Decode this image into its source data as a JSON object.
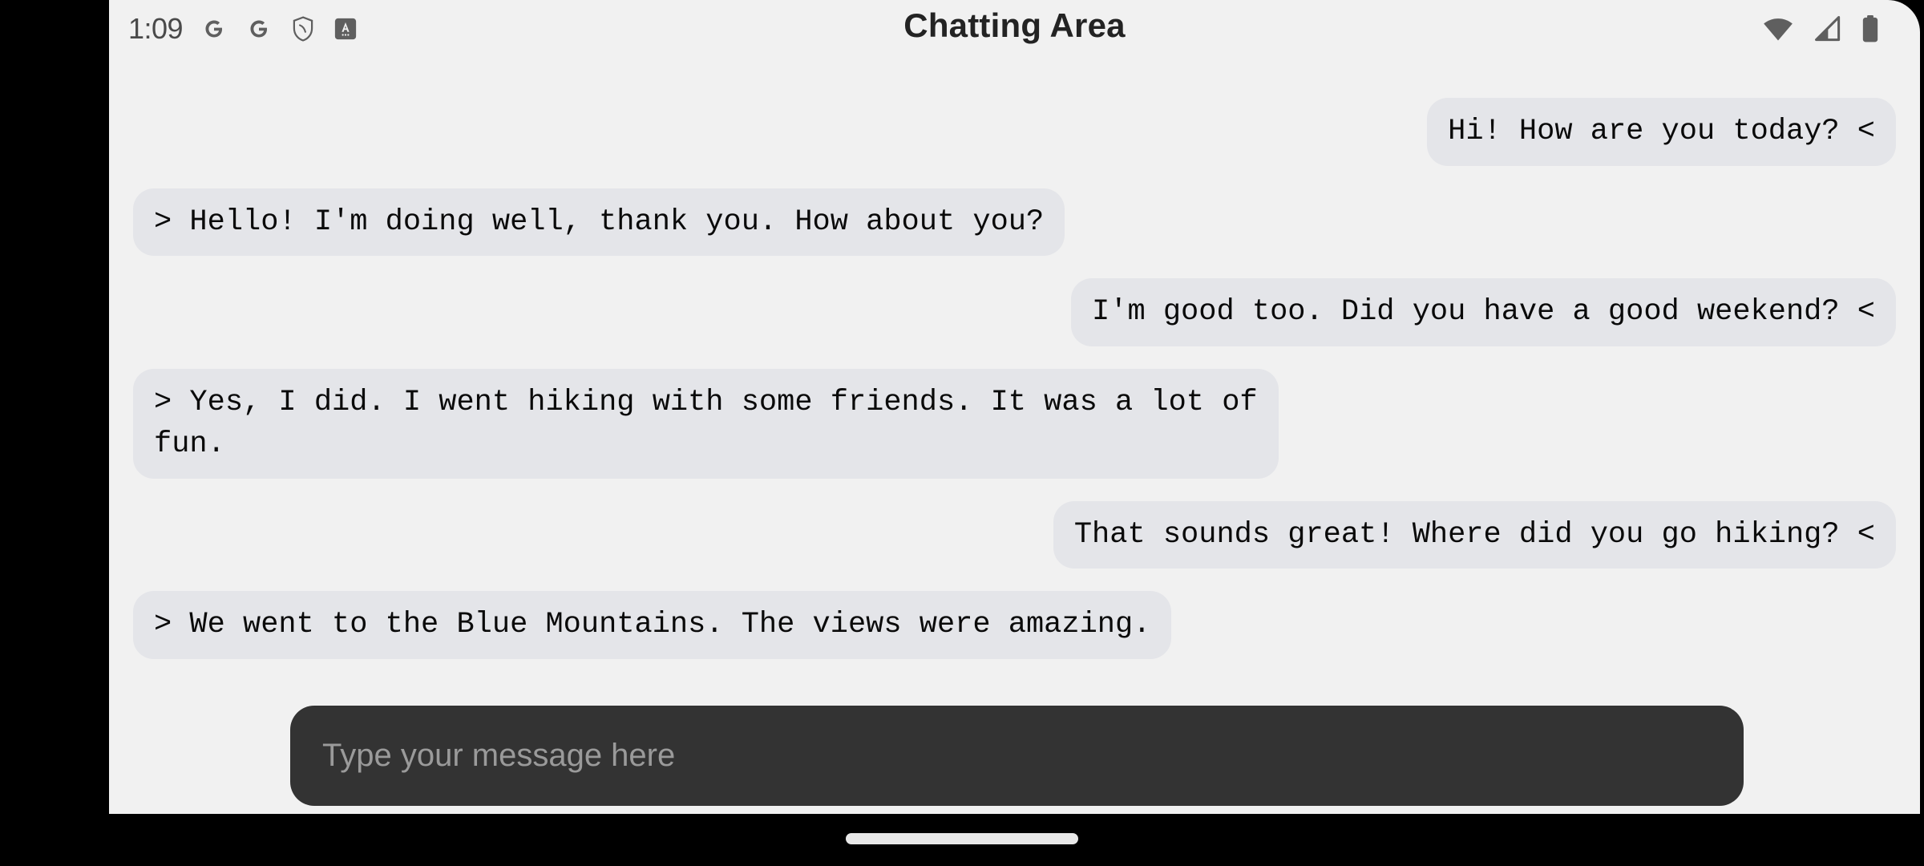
{
  "status_bar": {
    "clock": "1:09",
    "left_icons": [
      {
        "name": "google-icon",
        "label": "G"
      },
      {
        "name": "google-icon-2",
        "label": "G"
      },
      {
        "name": "shield-icon",
        "label": "shield"
      },
      {
        "name": "accessibility-badge-icon",
        "label": "A"
      }
    ],
    "right_icons": [
      {
        "name": "wifi-icon",
        "label": "wifi"
      },
      {
        "name": "cellular-signal-icon",
        "label": "signal"
      },
      {
        "name": "battery-icon",
        "label": "battery"
      }
    ]
  },
  "header": {
    "title": "Chatting Area"
  },
  "chat": {
    "messages": [
      {
        "side": "right",
        "text": "Hi! How are you today? <"
      },
      {
        "side": "left",
        "text": "> Hello! I'm doing well, thank you. How about you?"
      },
      {
        "side": "right",
        "text": "I'm good too. Did you have a good weekend? <"
      },
      {
        "side": "left",
        "text": "> Yes, I did. I went hiking with some friends. It was a lot of\nfun."
      },
      {
        "side": "right",
        "text": "That sounds great! Where did you go hiking? <"
      },
      {
        "side": "left",
        "text": "> We went to the Blue Mountains. The views were amazing."
      }
    ]
  },
  "composer": {
    "placeholder": "Type your message here",
    "value": ""
  },
  "navigation": {
    "home_indicator": "home-indicator"
  },
  "colors": {
    "background": "#f1f1f1",
    "bubble": "#e4e5e9",
    "input_background": "#333333",
    "title_text": "#232323",
    "status_icon": "#5f5f5f",
    "nav_bar": "#000000"
  }
}
